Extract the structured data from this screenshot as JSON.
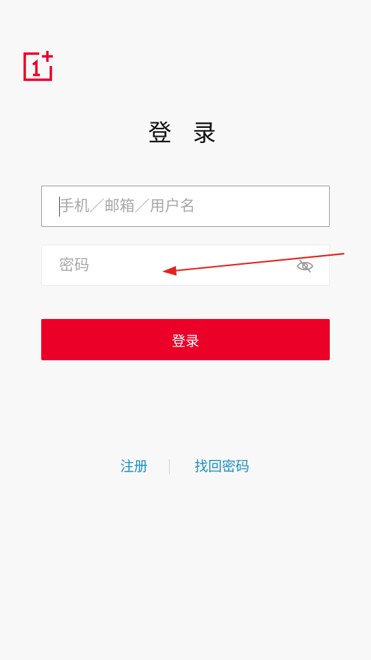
{
  "brand": {
    "logo_icon": "oneplus-logo-icon",
    "accent_color": "#eb0028"
  },
  "page": {
    "title": "登 录"
  },
  "form": {
    "username_placeholder": "手机／邮箱／用户名",
    "username_value": "",
    "password_placeholder": "密码",
    "password_value": "",
    "password_toggle_icon": "eye-hidden-icon",
    "submit_label": "登录"
  },
  "links": {
    "register_label": "注册",
    "forgot_password_label": "找回密码",
    "color": "#1b8fc0"
  },
  "annotation": {
    "arrow_color": "#e8201d"
  }
}
